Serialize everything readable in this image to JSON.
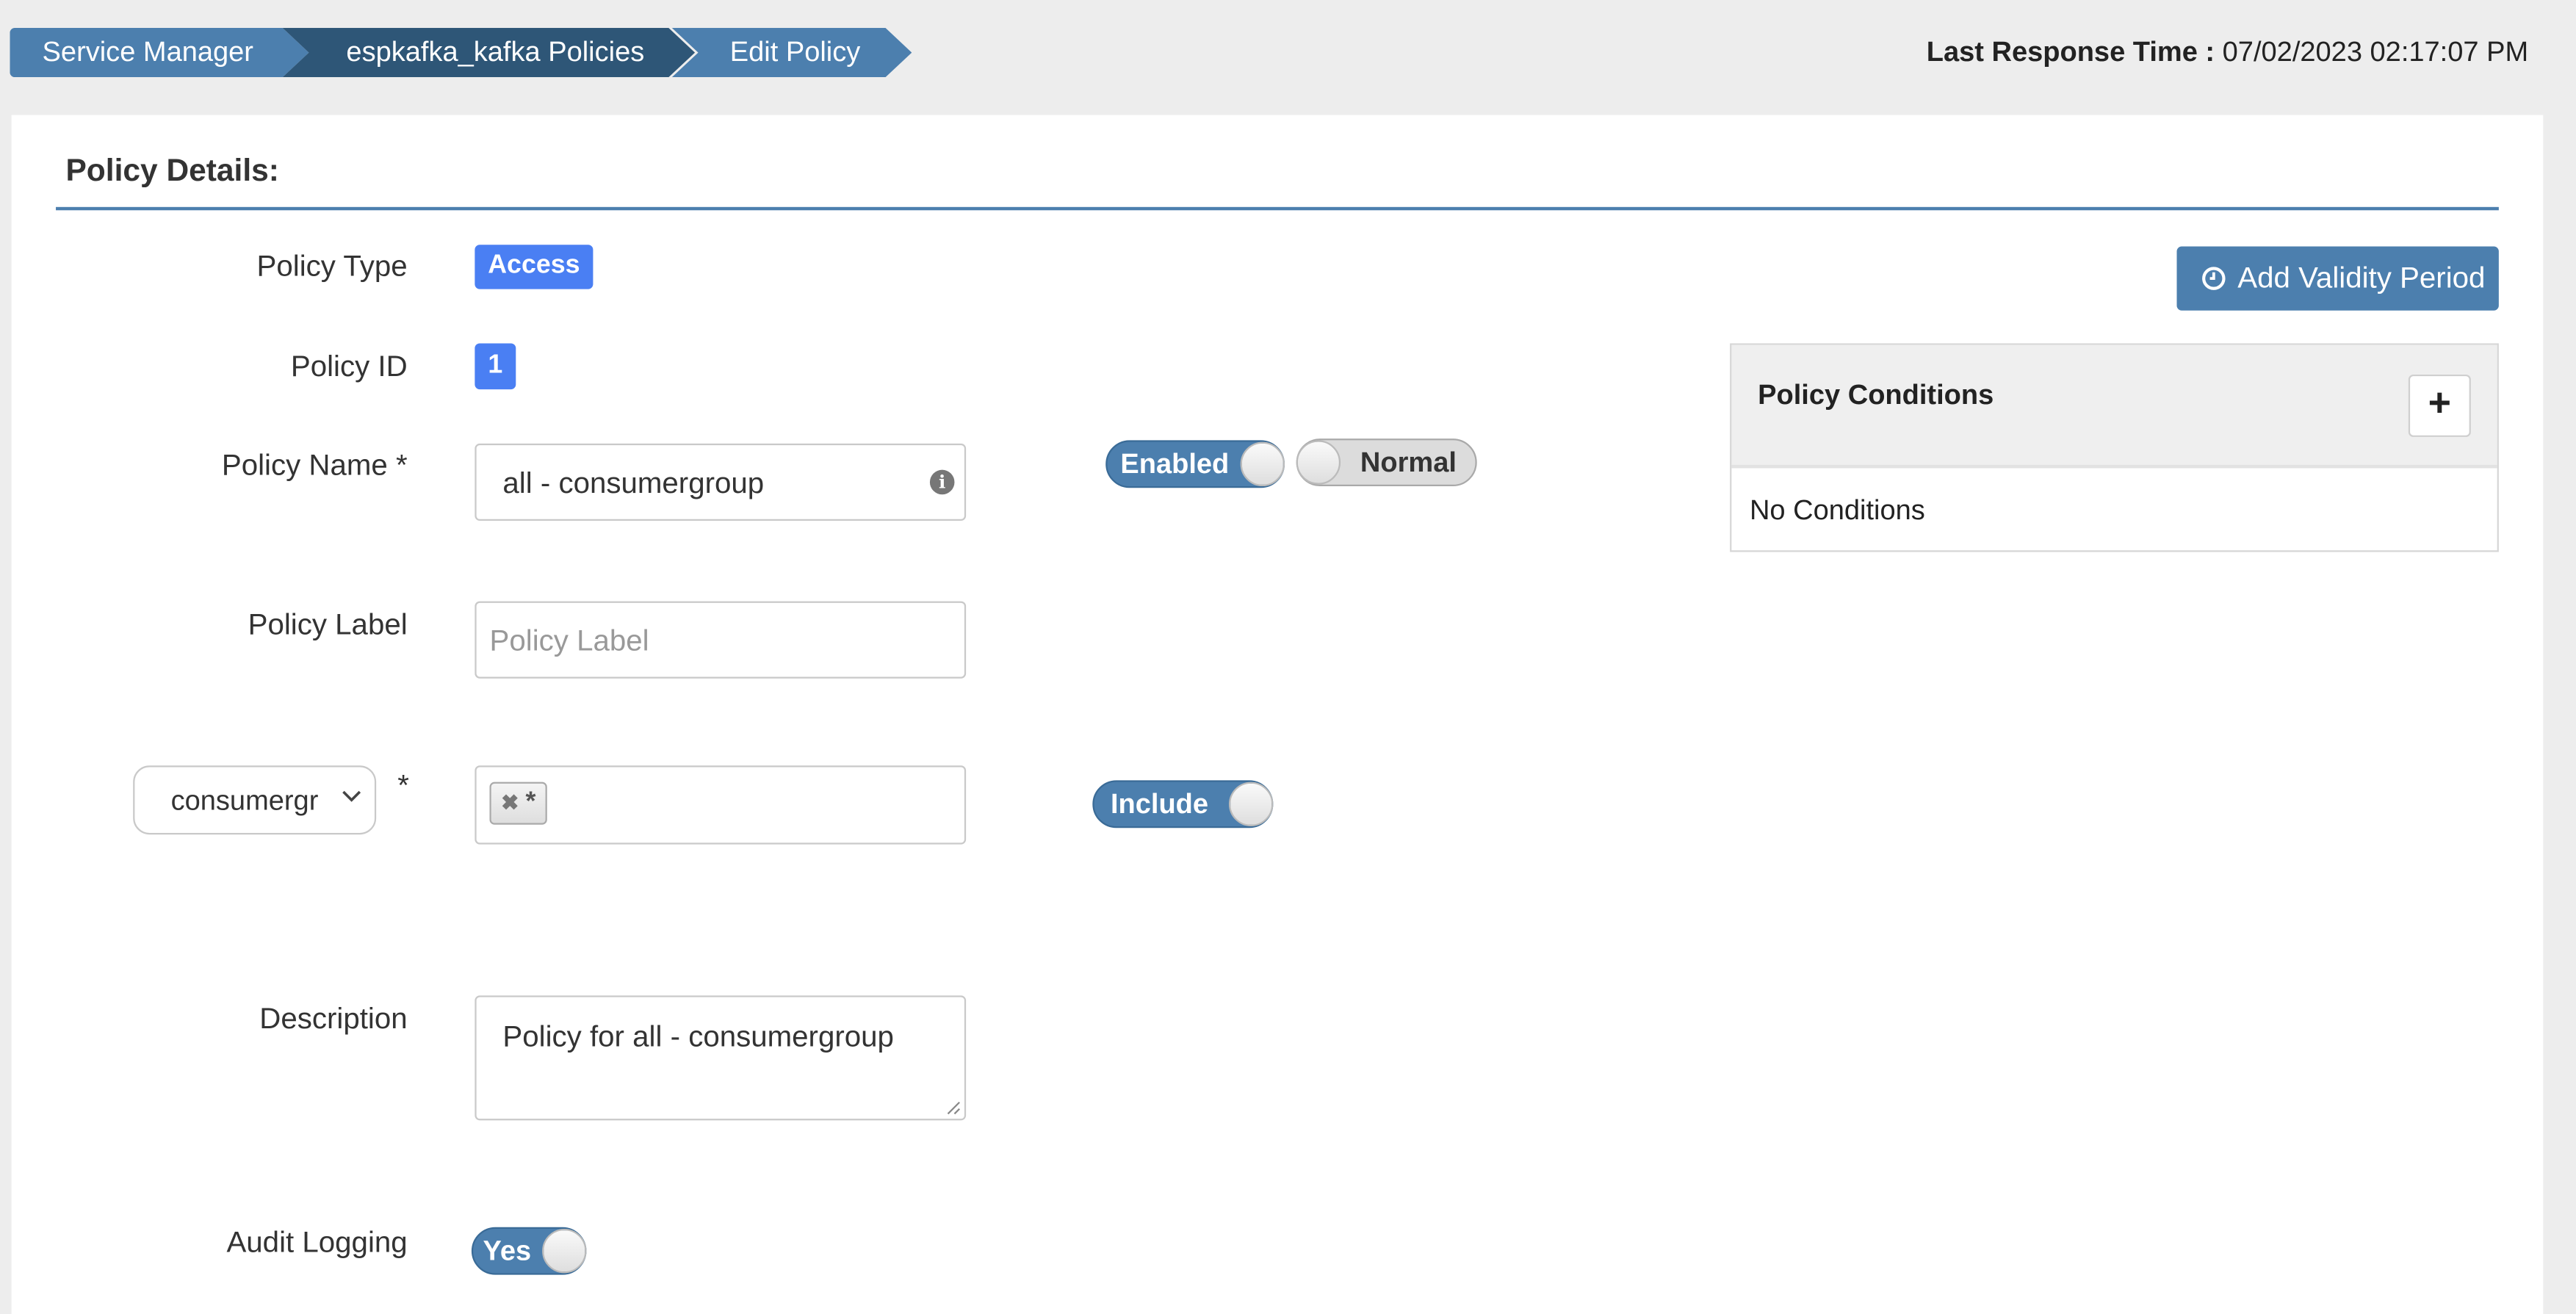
{
  "breadcrumb": {
    "items": [
      {
        "label": "Service Manager"
      },
      {
        "label": "espkafka_kafka Policies"
      },
      {
        "label": "Edit Policy"
      }
    ]
  },
  "last_response": {
    "label": "Last Response Time :",
    "value": "07/02/2023 02:17:07 PM"
  },
  "policy_details": {
    "title": "Policy Details:",
    "policy_type": {
      "label": "Policy Type",
      "value": "Access"
    },
    "policy_id": {
      "label": "Policy ID",
      "value": "1"
    },
    "policy_name": {
      "label": "Policy Name *",
      "value": "all - consumergroup"
    },
    "policy_label": {
      "label": "Policy Label",
      "placeholder": "Policy Label",
      "value": ""
    },
    "enabled_toggle": {
      "label": "Enabled",
      "state": "on"
    },
    "normal_toggle": {
      "label": "Normal",
      "state": "off"
    },
    "resource": {
      "type_select": "consumergroup",
      "type_select_display": "consumergr",
      "required_mark": "*",
      "tags": [
        "*"
      ],
      "include_toggle": {
        "label": "Include",
        "state": "on"
      }
    },
    "description": {
      "label": "Description",
      "value": "Policy for all - consumergroup"
    },
    "audit_logging": {
      "label": "Audit Logging",
      "value": "Yes",
      "state": "on"
    }
  },
  "sidebar": {
    "add_validity_button": "Add Validity Period",
    "conditions": {
      "title": "Policy Conditions",
      "add_icon": "+",
      "empty_text": "No Conditions"
    }
  },
  "colors": {
    "primary": "#4c7fae",
    "breadcrumb_active": "#2e5677",
    "badge": "#4a7ff3",
    "page_bg": "#ededed"
  }
}
